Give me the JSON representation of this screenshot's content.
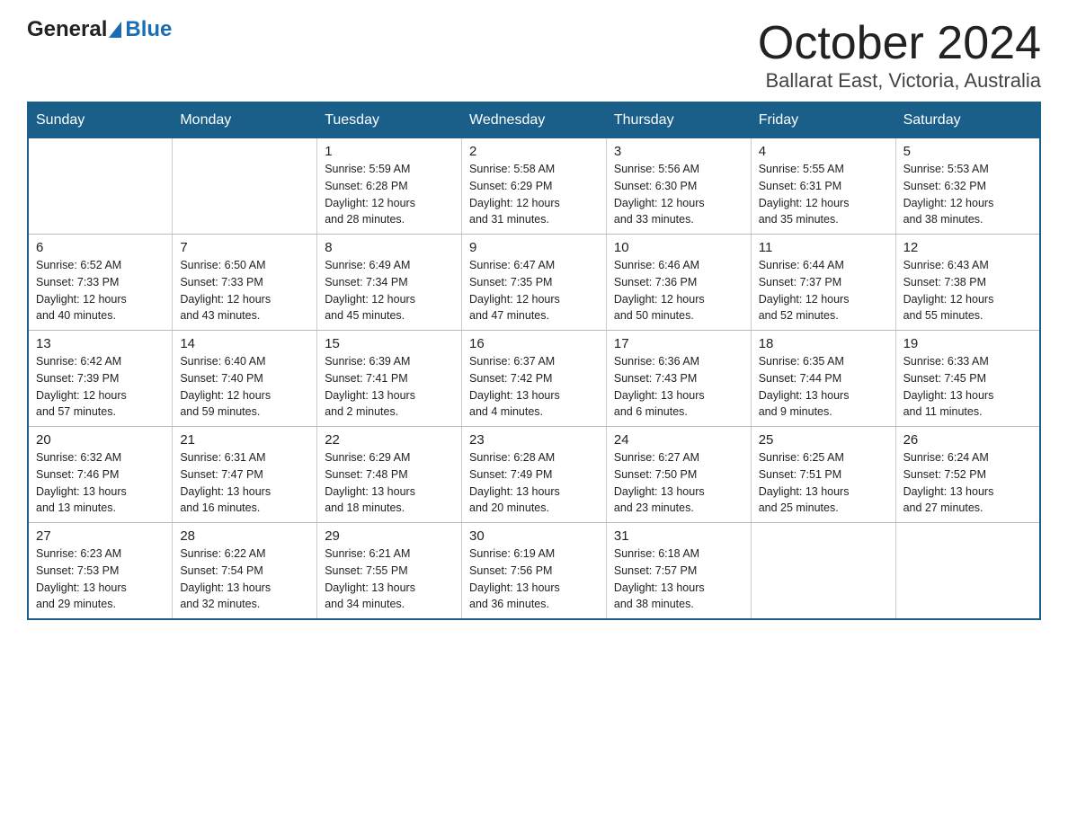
{
  "header": {
    "logo_general": "General",
    "logo_blue": "Blue",
    "title": "October 2024",
    "subtitle": "Ballarat East, Victoria, Australia"
  },
  "weekdays": [
    "Sunday",
    "Monday",
    "Tuesday",
    "Wednesday",
    "Thursday",
    "Friday",
    "Saturday"
  ],
  "weeks": [
    [
      {
        "day": "",
        "info": ""
      },
      {
        "day": "",
        "info": ""
      },
      {
        "day": "1",
        "info": "Sunrise: 5:59 AM\nSunset: 6:28 PM\nDaylight: 12 hours\nand 28 minutes."
      },
      {
        "day": "2",
        "info": "Sunrise: 5:58 AM\nSunset: 6:29 PM\nDaylight: 12 hours\nand 31 minutes."
      },
      {
        "day": "3",
        "info": "Sunrise: 5:56 AM\nSunset: 6:30 PM\nDaylight: 12 hours\nand 33 minutes."
      },
      {
        "day": "4",
        "info": "Sunrise: 5:55 AM\nSunset: 6:31 PM\nDaylight: 12 hours\nand 35 minutes."
      },
      {
        "day": "5",
        "info": "Sunrise: 5:53 AM\nSunset: 6:32 PM\nDaylight: 12 hours\nand 38 minutes."
      }
    ],
    [
      {
        "day": "6",
        "info": "Sunrise: 6:52 AM\nSunset: 7:33 PM\nDaylight: 12 hours\nand 40 minutes."
      },
      {
        "day": "7",
        "info": "Sunrise: 6:50 AM\nSunset: 7:33 PM\nDaylight: 12 hours\nand 43 minutes."
      },
      {
        "day": "8",
        "info": "Sunrise: 6:49 AM\nSunset: 7:34 PM\nDaylight: 12 hours\nand 45 minutes."
      },
      {
        "day": "9",
        "info": "Sunrise: 6:47 AM\nSunset: 7:35 PM\nDaylight: 12 hours\nand 47 minutes."
      },
      {
        "day": "10",
        "info": "Sunrise: 6:46 AM\nSunset: 7:36 PM\nDaylight: 12 hours\nand 50 minutes."
      },
      {
        "day": "11",
        "info": "Sunrise: 6:44 AM\nSunset: 7:37 PM\nDaylight: 12 hours\nand 52 minutes."
      },
      {
        "day": "12",
        "info": "Sunrise: 6:43 AM\nSunset: 7:38 PM\nDaylight: 12 hours\nand 55 minutes."
      }
    ],
    [
      {
        "day": "13",
        "info": "Sunrise: 6:42 AM\nSunset: 7:39 PM\nDaylight: 12 hours\nand 57 minutes."
      },
      {
        "day": "14",
        "info": "Sunrise: 6:40 AM\nSunset: 7:40 PM\nDaylight: 12 hours\nand 59 minutes."
      },
      {
        "day": "15",
        "info": "Sunrise: 6:39 AM\nSunset: 7:41 PM\nDaylight: 13 hours\nand 2 minutes."
      },
      {
        "day": "16",
        "info": "Sunrise: 6:37 AM\nSunset: 7:42 PM\nDaylight: 13 hours\nand 4 minutes."
      },
      {
        "day": "17",
        "info": "Sunrise: 6:36 AM\nSunset: 7:43 PM\nDaylight: 13 hours\nand 6 minutes."
      },
      {
        "day": "18",
        "info": "Sunrise: 6:35 AM\nSunset: 7:44 PM\nDaylight: 13 hours\nand 9 minutes."
      },
      {
        "day": "19",
        "info": "Sunrise: 6:33 AM\nSunset: 7:45 PM\nDaylight: 13 hours\nand 11 minutes."
      }
    ],
    [
      {
        "day": "20",
        "info": "Sunrise: 6:32 AM\nSunset: 7:46 PM\nDaylight: 13 hours\nand 13 minutes."
      },
      {
        "day": "21",
        "info": "Sunrise: 6:31 AM\nSunset: 7:47 PM\nDaylight: 13 hours\nand 16 minutes."
      },
      {
        "day": "22",
        "info": "Sunrise: 6:29 AM\nSunset: 7:48 PM\nDaylight: 13 hours\nand 18 minutes."
      },
      {
        "day": "23",
        "info": "Sunrise: 6:28 AM\nSunset: 7:49 PM\nDaylight: 13 hours\nand 20 minutes."
      },
      {
        "day": "24",
        "info": "Sunrise: 6:27 AM\nSunset: 7:50 PM\nDaylight: 13 hours\nand 23 minutes."
      },
      {
        "day": "25",
        "info": "Sunrise: 6:25 AM\nSunset: 7:51 PM\nDaylight: 13 hours\nand 25 minutes."
      },
      {
        "day": "26",
        "info": "Sunrise: 6:24 AM\nSunset: 7:52 PM\nDaylight: 13 hours\nand 27 minutes."
      }
    ],
    [
      {
        "day": "27",
        "info": "Sunrise: 6:23 AM\nSunset: 7:53 PM\nDaylight: 13 hours\nand 29 minutes."
      },
      {
        "day": "28",
        "info": "Sunrise: 6:22 AM\nSunset: 7:54 PM\nDaylight: 13 hours\nand 32 minutes."
      },
      {
        "day": "29",
        "info": "Sunrise: 6:21 AM\nSunset: 7:55 PM\nDaylight: 13 hours\nand 34 minutes."
      },
      {
        "day": "30",
        "info": "Sunrise: 6:19 AM\nSunset: 7:56 PM\nDaylight: 13 hours\nand 36 minutes."
      },
      {
        "day": "31",
        "info": "Sunrise: 6:18 AM\nSunset: 7:57 PM\nDaylight: 13 hours\nand 38 minutes."
      },
      {
        "day": "",
        "info": ""
      },
      {
        "day": "",
        "info": ""
      }
    ]
  ]
}
